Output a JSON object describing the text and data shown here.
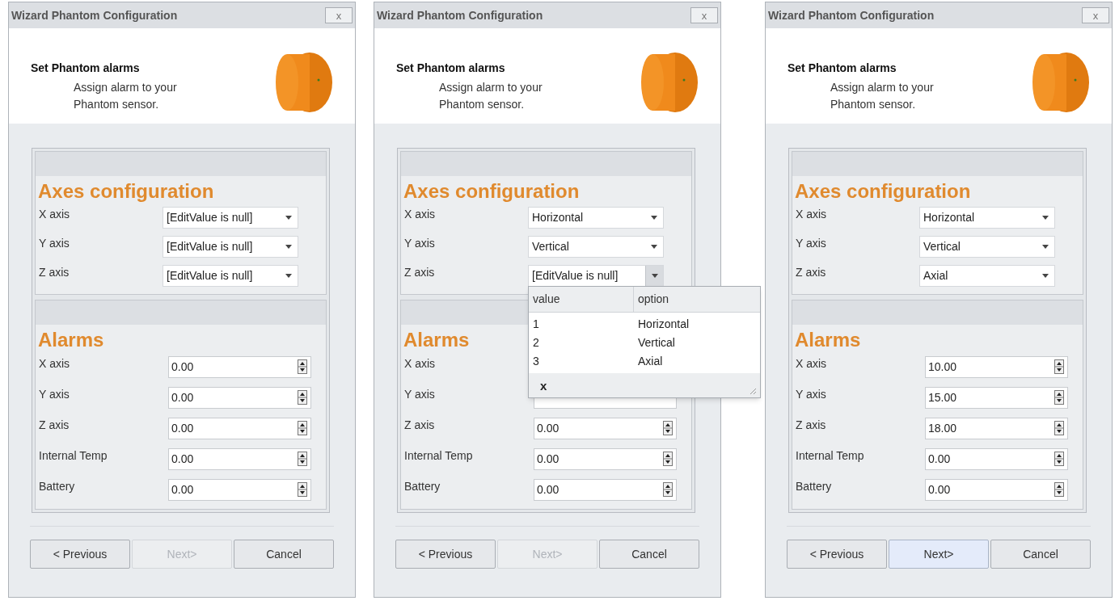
{
  "windows": [
    {
      "title": "Wizard Phantom Configuration",
      "close": "x",
      "header": {
        "title": "Set Phantom alarms",
        "subtitle": "Assign alarm to your Phantom sensor."
      },
      "axes": {
        "heading": "Axes configuration",
        "rows": [
          {
            "label": "X axis",
            "value": "[EditValue is null]",
            "open": false
          },
          {
            "label": "Y axis",
            "value": "[EditValue is null]",
            "open": false
          },
          {
            "label": "Z axis",
            "value": "[EditValue is null]",
            "open": false
          }
        ]
      },
      "alarms": {
        "heading": "Alarms",
        "rows": [
          {
            "label": "X axis",
            "value": "0.00"
          },
          {
            "label": "Y axis",
            "value": "0.00"
          },
          {
            "label": "Z axis",
            "value": "0.00"
          },
          {
            "label": "Internal Temp",
            "value": "0.00"
          },
          {
            "label": "Battery",
            "value": "0.00"
          }
        ]
      },
      "buttons": [
        {
          "label": "< Previous",
          "disabled": false,
          "highlighted": false
        },
        {
          "label": "Next>",
          "disabled": true,
          "highlighted": false
        },
        {
          "label": "Cancel",
          "disabled": false,
          "highlighted": false
        }
      ]
    },
    {
      "title": "Wizard Phantom Configuration",
      "close": "x",
      "header": {
        "title": "Set Phantom alarms",
        "subtitle": "Assign alarm to your Phantom sensor."
      },
      "axes": {
        "heading": "Axes configuration",
        "rows": [
          {
            "label": "X axis",
            "value": "Horizontal",
            "open": false
          },
          {
            "label": "Y axis",
            "value": "Vertical",
            "open": false
          },
          {
            "label": "Z axis",
            "value": "[EditValue is null]",
            "open": true,
            "dropdown": {
              "columns": [
                "value",
                "option"
              ],
              "rows": [
                [
                  "1",
                  "Horizontal"
                ],
                [
                  "2",
                  "Vertical"
                ],
                [
                  "3",
                  "Axial"
                ]
              ],
              "clear": "x"
            }
          }
        ]
      },
      "alarms": {
        "heading": "Alarms",
        "rows": [
          {
            "label": "X axis"
          },
          {
            "label": "Y axis"
          },
          {
            "label": "Z axis",
            "value": "0.00"
          },
          {
            "label": "Internal Temp",
            "value": "0.00"
          },
          {
            "label": "Battery",
            "value": "0.00"
          }
        ]
      },
      "buttons": [
        {
          "label": "< Previous",
          "disabled": false,
          "highlighted": false
        },
        {
          "label": "Next>",
          "disabled": true,
          "highlighted": false
        },
        {
          "label": "Cancel",
          "disabled": false,
          "highlighted": false
        }
      ]
    },
    {
      "title": "Wizard Phantom Configuration",
      "close": "x",
      "header": {
        "title": "Set Phantom alarms",
        "subtitle": "Assign alarm to your Phantom sensor."
      },
      "axes": {
        "heading": "Axes configuration",
        "rows": [
          {
            "label": "X axis",
            "value": "Horizontal",
            "open": false
          },
          {
            "label": "Y axis",
            "value": "Vertical",
            "open": false
          },
          {
            "label": "Z axis",
            "value": "Axial",
            "open": false
          }
        ]
      },
      "alarms": {
        "heading": "Alarms",
        "rows": [
          {
            "label": "X axis",
            "value": "10.00"
          },
          {
            "label": "Y axis",
            "value": "15.00"
          },
          {
            "label": "Z axis",
            "value": "18.00"
          },
          {
            "label": "Internal Temp",
            "value": "0.00"
          },
          {
            "label": "Battery",
            "value": "0.00"
          }
        ]
      },
      "buttons": [
        {
          "label": "< Previous",
          "disabled": false,
          "highlighted": false
        },
        {
          "label": "Next>",
          "disabled": false,
          "highlighted": true
        },
        {
          "label": "Cancel",
          "disabled": false,
          "highlighted": false
        }
      ]
    }
  ]
}
